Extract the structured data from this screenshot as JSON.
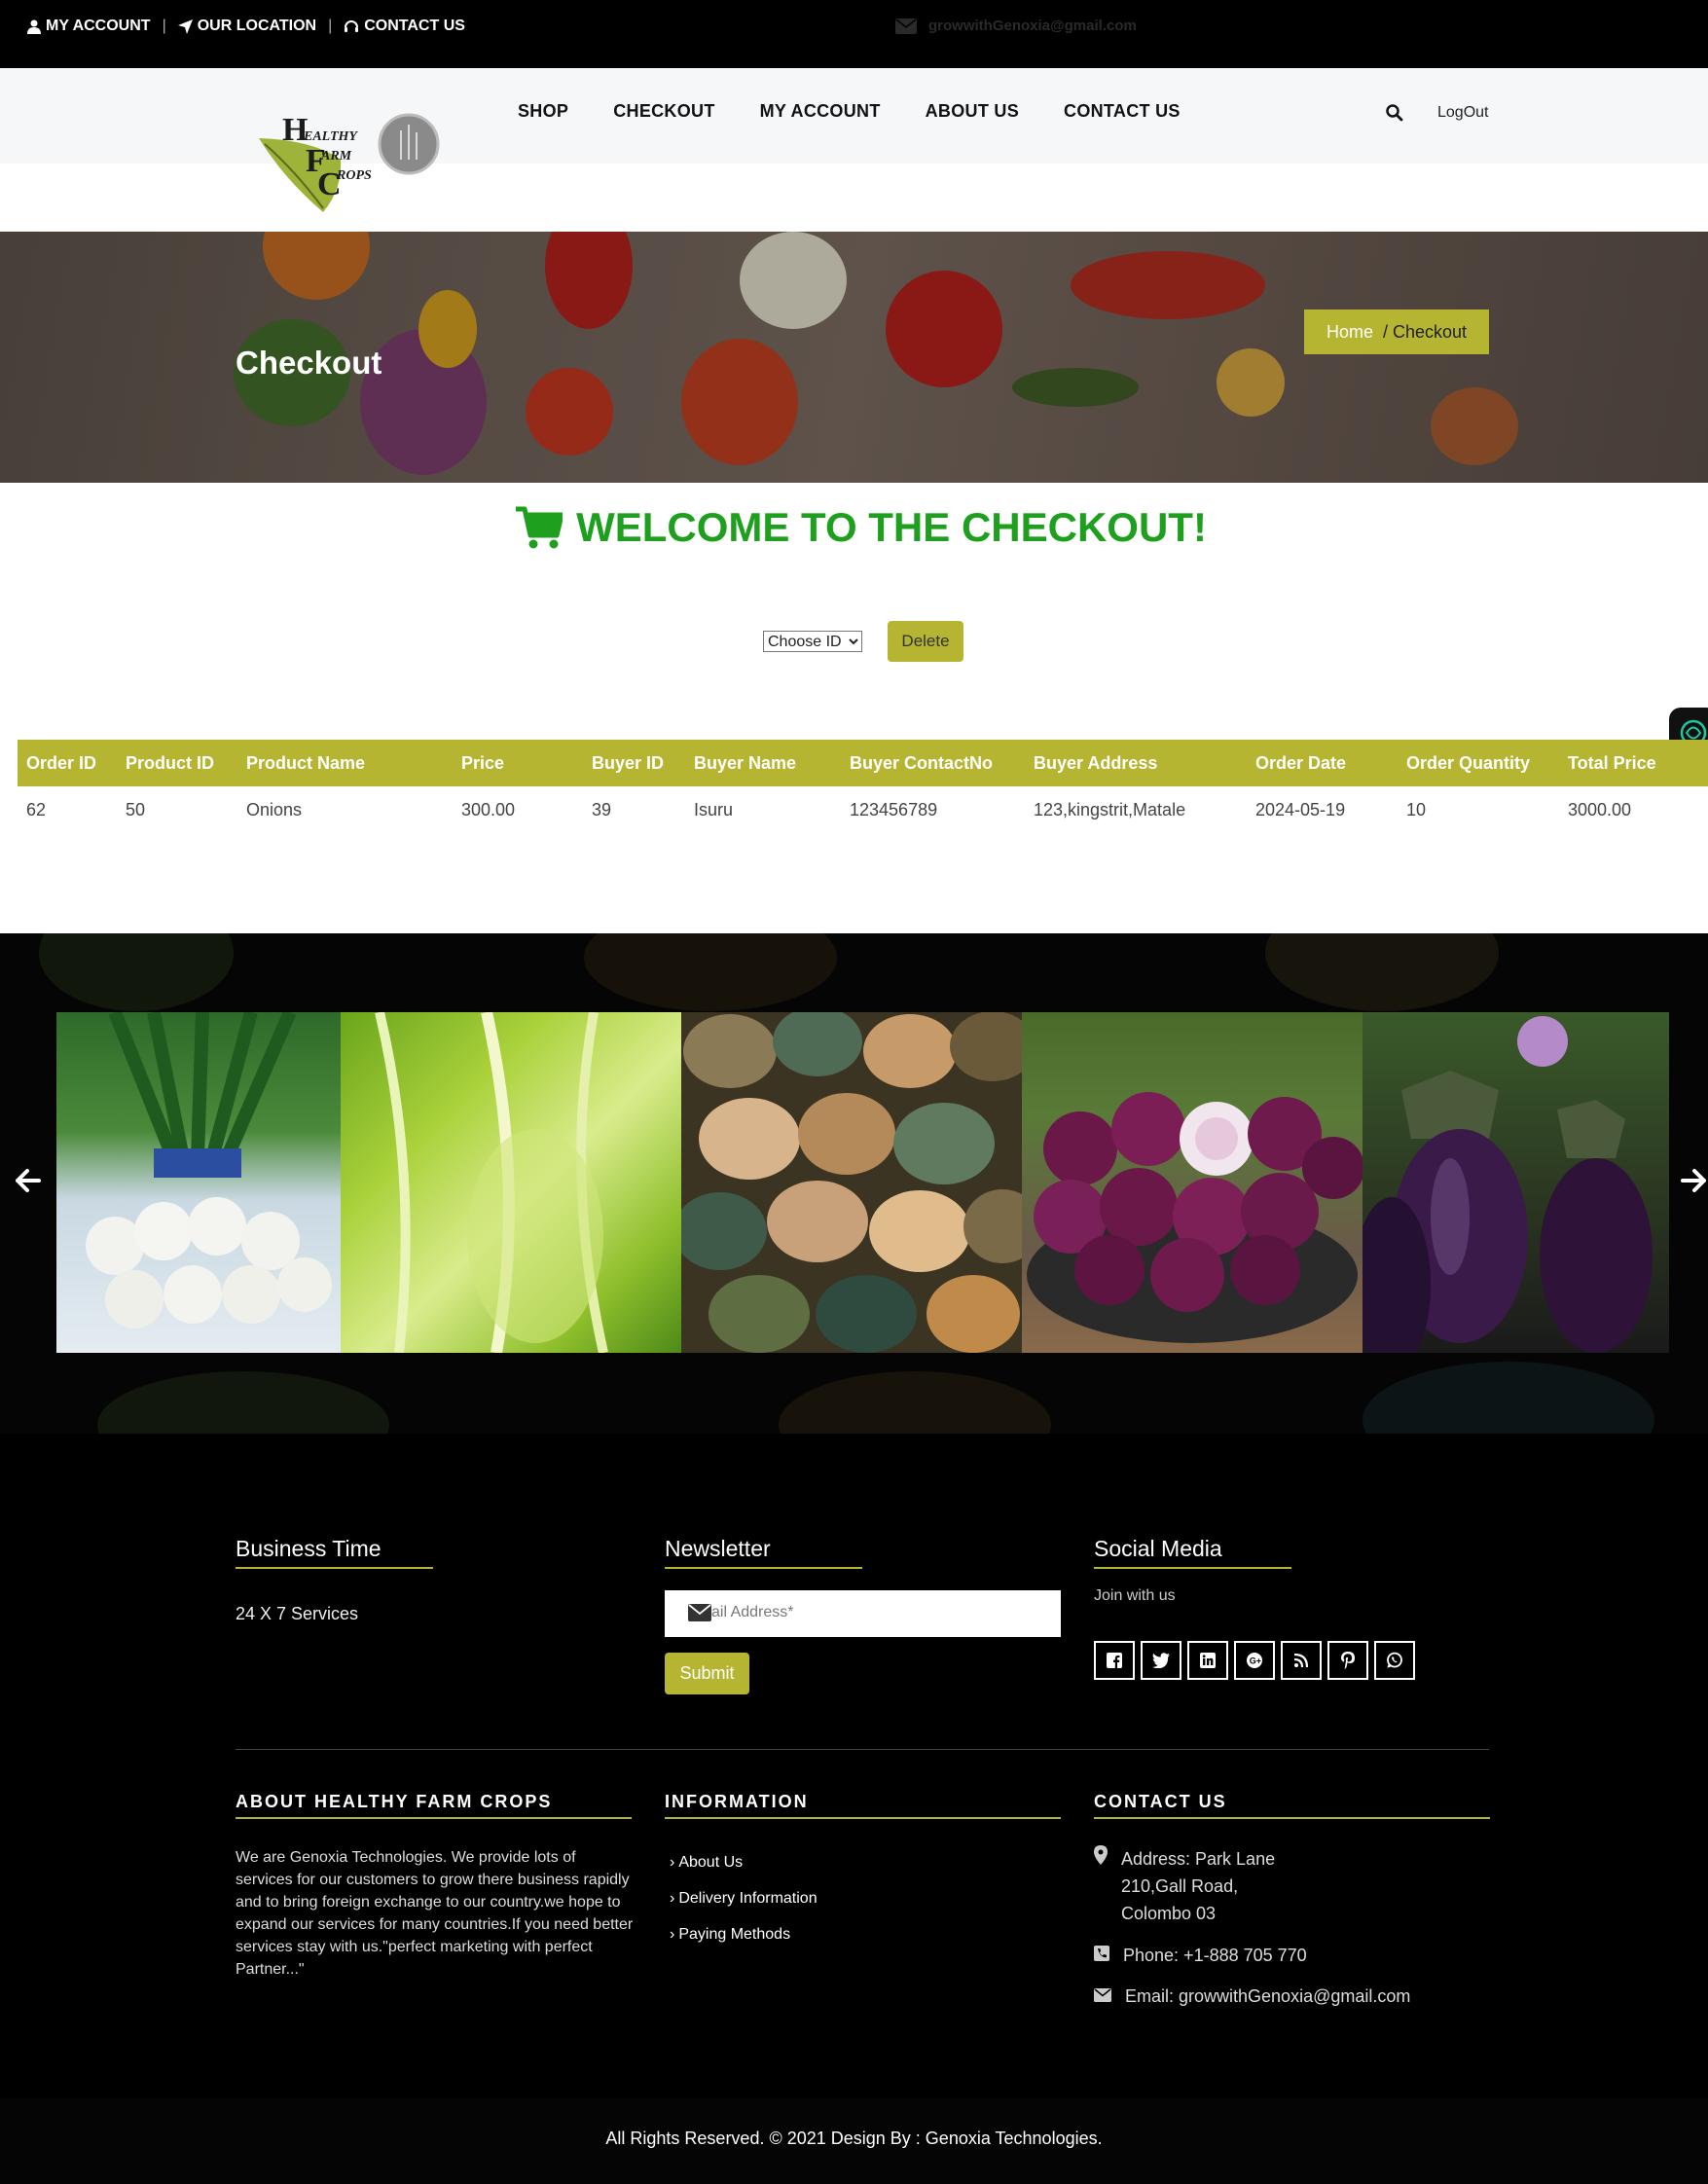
{
  "topbar": {
    "my_account": "MY ACCOUNT",
    "our_location": "OUR LOCATION",
    "contact_us": "CONTACT US",
    "email": "growwithGenoxia@gmail.com"
  },
  "header": {
    "logo_text": "HEALTHY FARM CROPS",
    "nav": [
      "SHOP",
      "CHECKOUT",
      "MY ACCOUNT",
      "ABOUT US",
      "CONTACT US"
    ],
    "logout": "LogOut"
  },
  "banner": {
    "title": "Checkout",
    "breadcrumb_home": "Home",
    "breadcrumb_current": "/ Checkout"
  },
  "main": {
    "welcome": "WELCOME TO THE CHECKOUT!",
    "select_value": "Choose ID",
    "delete_label": "Delete"
  },
  "table": {
    "headers": [
      "Order ID",
      "Product ID",
      "Product Name",
      "Price",
      "Buyer ID",
      "Buyer Name",
      "Buyer ContactNo",
      "Buyer Address",
      "Order Date",
      "Order Quantity",
      "Total Price"
    ],
    "rows": [
      [
        "62",
        "50",
        "Onions",
        "300.00",
        "39",
        "Isuru",
        "123456789",
        "123,kingstrit,Matale",
        "2024-05-19",
        "10",
        "3000.00"
      ]
    ]
  },
  "gallery": {
    "items": [
      "turnip",
      "lettuce",
      "pumpkin",
      "onion",
      "eggplant"
    ]
  },
  "footer": {
    "business_time_title": "Business Time",
    "business_time_text": "24 X 7 Services",
    "newsletter_title": "Newsletter",
    "email_placeholder": "Email Address*",
    "submit_label": "Submit",
    "social_title": "Social Media",
    "social_text": "Join with us",
    "social_icons": [
      "facebook-icon",
      "twitter-icon",
      "linkedin-icon",
      "google-plus-icon",
      "rss-icon",
      "pinterest-icon",
      "whatsapp-icon"
    ],
    "about_title": "ABOUT HEALTHY FARM CROPS",
    "about_text": "We are Genoxia Technologies. We provide lots of services for our customers to grow there business rapidly and to bring foreign exchange to our country.we hope to expand our services for many countries.If you need better services stay with us.\"perfect marketing with perfect Partner...\"",
    "info_title": "INFORMATION",
    "info_links": [
      "About Us",
      "Delivery Information",
      "Paying Methods"
    ],
    "contact_title": "CONTACT US",
    "address_line1": "Address: Park Lane",
    "address_line2": "210,Gall Road,",
    "address_line3": "Colombo 03",
    "phone": "Phone: +1-888 705 770",
    "email": "Email: growwithGenoxia@gmail.com",
    "copyright": "All Rights Reserved. © 2021 Design By : Genoxia Technologies."
  },
  "colors": {
    "accent": "#b5b532",
    "welcome_green": "#1ea01e",
    "topbar_bg": "#000000"
  }
}
